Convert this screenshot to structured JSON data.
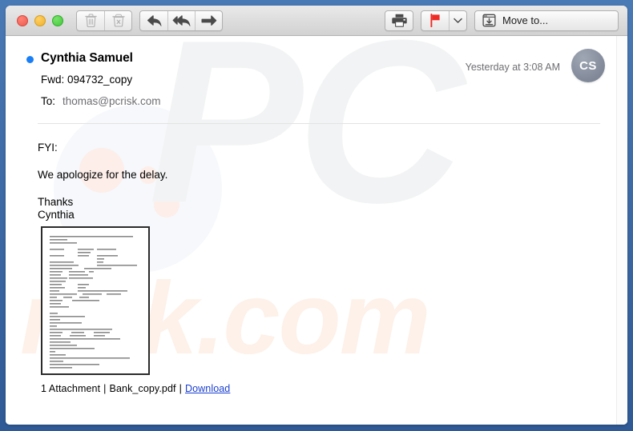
{
  "window": {
    "traffic_lights": [
      "close",
      "minimize",
      "maximize"
    ],
    "frame_color": "#3f6ba6"
  },
  "toolbar": {
    "delete_label": "Delete",
    "junk_label": "Junk",
    "reply_label": "Reply",
    "reply_all_label": "Reply All",
    "forward_label": "Forward",
    "print_label": "Print",
    "flag_label": "Flag",
    "flag_color": "#ee2b24",
    "flag_caret_label": "Flag options",
    "move_to_label": "Move to..."
  },
  "message": {
    "sender": "Cynthia Samuel",
    "unread": true,
    "unread_dot_color": "#1a7ef6",
    "timestamp": "Yesterday at 3:08 AM",
    "avatar_initials": "CS",
    "subject": "Fwd: 094732_copy",
    "to_label": "To:",
    "to_value": "thomas@pcrisk.com",
    "body": [
      "FYI:",
      "We apologize for the delay.",
      "Thanks\nCynthia"
    ],
    "body_lines": {
      "line1": "FYI:",
      "line2": "We apologize for the delay.",
      "line3": "Thanks",
      "line4": "Cynthia"
    }
  },
  "attachment": {
    "count_label": "1 Attachment",
    "separator": "|",
    "filename": "Bank_copy.pdf",
    "download_label": "Download",
    "download_link_color": "#1a3fd0",
    "preview_alt": "document-preview-thumbnail"
  },
  "watermark": {
    "primary": "PC",
    "secondary": "risk.com",
    "primary_color": "#f2f3f4",
    "secondary_color": "#fdf1e9"
  }
}
